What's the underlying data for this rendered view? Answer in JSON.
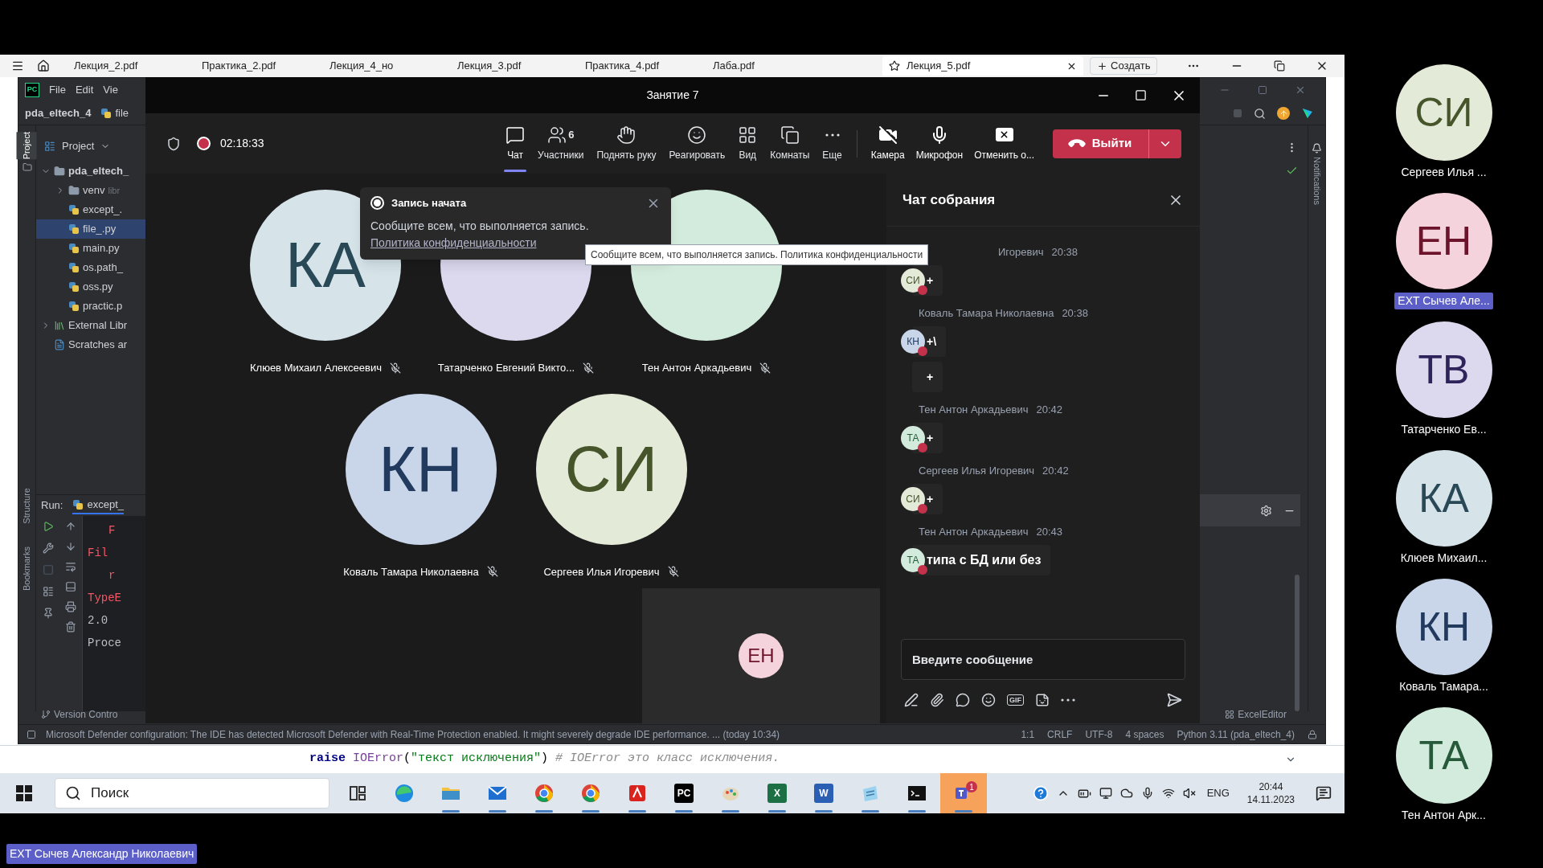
{
  "browser": {
    "tabs": [
      {
        "label": "Лекция_2.pdf",
        "selected": false
      },
      {
        "label": "Практика_2.pdf",
        "selected": false
      },
      {
        "label": "Лекция_4_но",
        "selected": false
      },
      {
        "label": "Лекция_3.pdf",
        "selected": false
      },
      {
        "label": "Практика_4.pdf",
        "selected": false
      },
      {
        "label": "Лаба.pdf",
        "selected": false
      },
      {
        "label": "Лекция_5.pdf",
        "selected": true
      }
    ],
    "new_tab": "Создать",
    "code_line": [
      {
        "text": "raise",
        "kind": "keyword"
      },
      {
        "text": " IOError",
        "kind": "builtin"
      },
      {
        "text": "(",
        "kind": "plain"
      },
      {
        "text": "\"текст исключения\"",
        "kind": "string"
      },
      {
        "text": ") ",
        "kind": "plain"
      },
      {
        "text": "# IOError это класс исключения.",
        "kind": "comment"
      }
    ]
  },
  "ide": {
    "logo": "PC",
    "menu": [
      "File",
      "Edit",
      "Vie"
    ],
    "project": "pda_eltech_4",
    "crumb": "file",
    "side_tab": {
      "label": "Project",
      "selected": true
    },
    "panel_title": "Project",
    "tree": [
      {
        "label": "pda_eltech_",
        "kind": "folder",
        "expanded": true,
        "selected": false,
        "children": [
          {
            "label": "venv",
            "kind": "folder",
            "expanded": false,
            "selected": false,
            "note": "libr"
          },
          {
            "label": "except_.",
            "kind": "file",
            "selected": false
          },
          {
            "label": "file_.py",
            "kind": "file",
            "selected": true
          },
          {
            "label": "main.py",
            "kind": "file",
            "selected": false
          },
          {
            "label": "os.path_",
            "kind": "file",
            "selected": false
          },
          {
            "label": "oss.py",
            "kind": "file",
            "selected": false
          },
          {
            "label": "practic.p",
            "kind": "file",
            "selected": false
          }
        ]
      },
      {
        "label": "External Libr",
        "kind": "library",
        "expanded": false,
        "selected": false
      },
      {
        "label": "Scratches ar",
        "kind": "scratch",
        "selected": false
      }
    ],
    "run_label": "Run:",
    "run_tab": "except_",
    "console": [
      {
        "text": "F",
        "kind": "error",
        "indent": true
      },
      {
        "text": "Fil",
        "kind": "error",
        "indent": false
      },
      {
        "text": "r",
        "kind": "error",
        "indent": true
      },
      {
        "text": "TypeE",
        "kind": "error",
        "indent": false
      },
      {
        "text": "2.0",
        "kind": "normal",
        "indent": false
      },
      {
        "text": "Proce",
        "kind": "normal",
        "indent": false
      }
    ],
    "left_tabs": [
      {
        "label": "Structure",
        "selected": false
      },
      {
        "label": "Bookmarks",
        "selected": false
      }
    ],
    "right_tab": "Notifications",
    "bottom_tab": "Version Contro",
    "excel": "ExcelEditor",
    "status": "Microsoft Defender configuration: The IDE has detected Microsoft Defender with Real-Time Protection enabled. It might severely degrade IDE performance. ... (today 10:34)",
    "status_items": [
      "1:1",
      "CRLF",
      "UTF-8",
      "4 spaces",
      "Python 3.11 (pda_eltech_4)"
    ]
  },
  "meeting": {
    "title": "Занятие 7",
    "recording": true,
    "timer": "02:18:33",
    "toolbar": [
      {
        "label": "Чат",
        "kind": "chat",
        "selected": true
      },
      {
        "label": "Участники",
        "kind": "people",
        "selected": false,
        "count": "6"
      },
      {
        "label": "Поднять руку",
        "kind": "hand",
        "selected": false
      },
      {
        "label": "Реагировать",
        "kind": "react",
        "selected": false
      },
      {
        "label": "Вид",
        "kind": "view",
        "selected": false
      },
      {
        "label": "Комнаты",
        "kind": "rooms",
        "selected": false
      },
      {
        "label": "Еще",
        "kind": "more",
        "selected": false
      }
    ],
    "devices": [
      {
        "label": "Камера",
        "kind": "camera",
        "on": false
      },
      {
        "label": "Микрофон",
        "kind": "mic",
        "on": true
      },
      {
        "label": "Отменить о...",
        "kind": "share",
        "on": true
      }
    ],
    "leave": "Выйти",
    "participants": [
      {
        "initials": "КА",
        "name": "Клюев Михаил Алексеевич",
        "color": "#d6e4ea",
        "muted": true
      },
      {
        "name": "Татарченко Евгений Викто...",
        "color": "#dcd8ee",
        "muted": true
      },
      {
        "name": "Тен Антон Аркадьевич",
        "color": "#d3ebdc",
        "muted": true
      },
      {
        "initials": "КН",
        "name": "Коваль Тамара Николаевна",
        "color": "#c9d6ea",
        "muted": true
      },
      {
        "initials": "СИ",
        "name": "Сергеев Илья Игоревич",
        "color": "#e4ead8",
        "muted": true
      }
    ],
    "notification": {
      "title": "Запись начата",
      "text": "Сообщите всем, что выполняется запись.",
      "link": "Политика конфиденциальности"
    },
    "tooltip": "Сообщите всем, что выполняется запись. Политика конфиденциальности",
    "self": {
      "initials": "ЕН",
      "color": "#f5d3dc"
    },
    "chat": {
      "title": "Чат собрания",
      "placeholder": "Введите сообщение",
      "messages": [
        {
          "author": "Игоревич",
          "time": "20:38",
          "initials": "СИ",
          "color": "#e4ead8",
          "texts": [
            "+"
          ]
        },
        {
          "author": "Коваль Тамара Николаевна",
          "time": "20:38",
          "initials": "КН",
          "color": "#c9d6ea",
          "texts": [
            "+\\",
            "+"
          ]
        },
        {
          "author": "Тен Антон Аркадьевич",
          "time": "20:42",
          "initials": "ТА",
          "color": "#d3ebdc",
          "texts": [
            "+"
          ]
        },
        {
          "author": "Сергеев Илья Игоревич",
          "time": "20:42",
          "initials": "СИ",
          "color": "#e4ead8",
          "texts": [
            "+"
          ]
        },
        {
          "author": "Тен Антон Аркадьевич",
          "time": "20:43",
          "initials": "ТА",
          "color": "#d3ebdc",
          "texts": [
            "типа с БД или без"
          ]
        }
      ],
      "compose": [
        {
          "kind": "format"
        },
        {
          "kind": "attach"
        },
        {
          "kind": "loop"
        },
        {
          "kind": "emoji"
        },
        {
          "kind": "gif",
          "label": "GIF"
        },
        {
          "kind": "sticker"
        },
        {
          "kind": "more"
        }
      ]
    }
  },
  "taskbar": {
    "search": "Поиск",
    "apps": [
      {
        "kind": "taskview",
        "running": false,
        "flashing": false
      },
      {
        "kind": "edge",
        "running": false,
        "flashing": false
      },
      {
        "kind": "folder",
        "running": true,
        "flashing": false
      },
      {
        "kind": "mail",
        "running": true,
        "flashing": false
      },
      {
        "kind": "chrome",
        "running": true,
        "flashing": false
      },
      {
        "kind": "chrome",
        "running": true,
        "flashing": false
      },
      {
        "kind": "pdf",
        "running": true,
        "flashing": false
      },
      {
        "kind": "ide",
        "glyph": "PC",
        "running": true,
        "flashing": false
      },
      {
        "kind": "paint",
        "running": true,
        "flashing": false
      },
      {
        "kind": "excel",
        "glyph": "X",
        "running": true,
        "flashing": false
      },
      {
        "kind": "word",
        "glyph": "W",
        "running": true,
        "flashing": false
      },
      {
        "kind": "notepad",
        "running": true,
        "flashing": false
      },
      {
        "kind": "terminal",
        "running": true,
        "flashing": false
      },
      {
        "kind": "teams",
        "badge": "1",
        "running": true,
        "flashing": true
      }
    ],
    "lang": "ENG",
    "time": "20:44",
    "date": "14.11.2023"
  },
  "gallery": [
    {
      "initials": "СИ",
      "name": "Сергеев Илья ...",
      "color": "#e4ead8",
      "highlighted": false
    },
    {
      "initials": "ЕН",
      "name": "EXT Сычев Але...",
      "color": "#f5d3dc",
      "highlighted": true
    },
    {
      "initials": "ТВ",
      "name": "Татарченко Ев...",
      "color": "#dcd8ee",
      "highlighted": false
    },
    {
      "initials": "КА",
      "name": "Клюев Михаил...",
      "color": "#d6e4ea",
      "highlighted": false
    },
    {
      "initials": "КН",
      "name": "Коваль Тамара...",
      "color": "#c9d6ea",
      "highlighted": false
    },
    {
      "initials": "ТА",
      "name": "Тен Антон Арк...",
      "color": "#d3ebdc",
      "highlighted": false
    }
  ],
  "caption": "EXT Сычев Александр Николаевич"
}
